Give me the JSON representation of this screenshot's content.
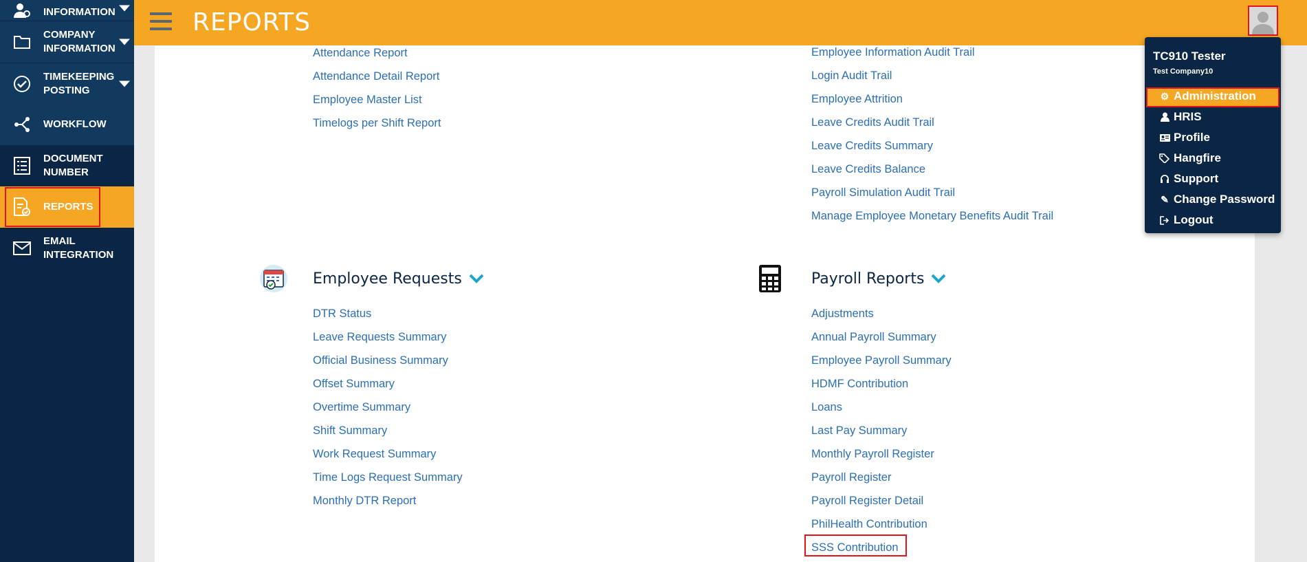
{
  "header": {
    "title": "REPORTS"
  },
  "sidebar": {
    "items": [
      {
        "label": "INFORMATION"
      },
      {
        "label": "COMPANY INFORMATION"
      },
      {
        "label": "TIMEKEEPING POSTING"
      },
      {
        "label": "WORKFLOW"
      },
      {
        "label": "DOCUMENT NUMBER"
      },
      {
        "label": "REPORTS"
      },
      {
        "label": "EMAIL INTEGRATION"
      }
    ]
  },
  "user_menu": {
    "name": "TC910 Tester",
    "company": "Test Company10",
    "items": [
      {
        "label": "Administration",
        "icon": "gear-icon"
      },
      {
        "label": "HRIS",
        "icon": "user-icon"
      },
      {
        "label": "Profile",
        "icon": "id-card-icon"
      },
      {
        "label": "Hangfire",
        "icon": "tags-icon"
      },
      {
        "label": "Support",
        "icon": "headset-icon"
      },
      {
        "label": "Change Password",
        "icon": "pencil-icon"
      },
      {
        "label": "Logout",
        "icon": "sign-out-icon"
      }
    ]
  },
  "reports": {
    "top_left_links": [
      "Attendance Report",
      "Attendance Detail Report",
      "Employee Master List",
      "Timelogs per Shift Report"
    ],
    "top_right_links": [
      "Employee Information Audit Trail",
      "Login Audit Trail",
      "Employee Attrition",
      "Leave Credits Audit Trail",
      "Leave Credits Summary",
      "Leave Credits Balance",
      "Payroll Simulation Audit Trail",
      "Manage Employee Monetary Benefits Audit Trail"
    ],
    "employee_requests": {
      "title": "Employee Requests",
      "icon": "calendar-check-icon",
      "links": [
        "DTR Status",
        "Leave Requests Summary",
        "Official Business Summary",
        "Offset Summary",
        "Overtime Summary",
        "Shift Summary",
        "Work Request Summary",
        "Time Logs Request Summary",
        "Monthly DTR Report"
      ]
    },
    "payroll_reports": {
      "title": "Payroll Reports",
      "icon": "calculator-icon",
      "links": [
        "Adjustments",
        "Annual Payroll Summary",
        "Employee Payroll Summary",
        "HDMF Contribution",
        "Loans",
        "Last Pay Summary",
        "Monthly Payroll Register",
        "Payroll Register",
        "Payroll Register Detail",
        "PhilHealth Contribution",
        "SSS Contribution"
      ]
    }
  },
  "colors": {
    "sidebar": "#0b2545",
    "accent": "#f5a623",
    "link": "#2c6fb3",
    "highlight": "#e3141b"
  }
}
